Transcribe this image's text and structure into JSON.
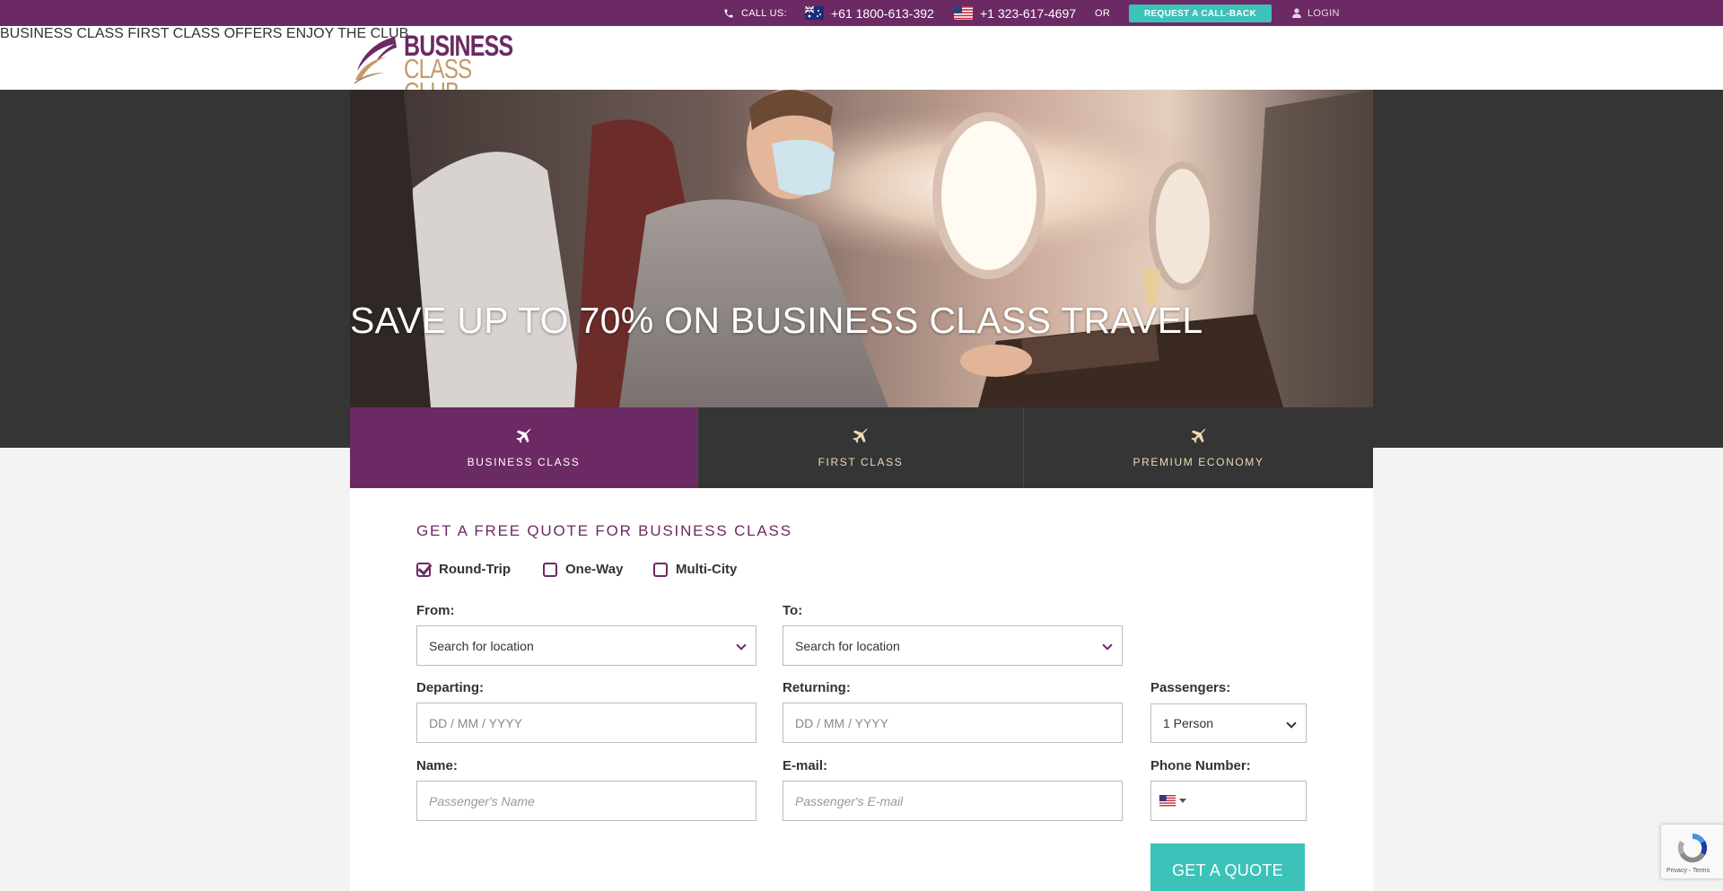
{
  "topbar": {
    "call_us": "CALL US:",
    "phone_au": "+61 1800-613-392",
    "phone_us": "+1 323-617-4697",
    "or": "OR",
    "callback": "REQUEST A CALL-BACK",
    "login": "LOGIN"
  },
  "logo": {
    "line1": "BUSINESS",
    "line2": "CLASS CLUB"
  },
  "nav": [
    "BUSINESS CLASS",
    "FIRST CLASS",
    "OFFERS",
    "ENJOY THE CLUB"
  ],
  "hero": {
    "title": "SAVE UP TO 70% ON BUSINESS CLASS TRAVEL"
  },
  "tabs": [
    {
      "label": "BUSINESS CLASS",
      "active": true
    },
    {
      "label": "FIRST CLASS",
      "active": false
    },
    {
      "label": "PREMIUM ECONOMY",
      "active": false
    }
  ],
  "form": {
    "title": "GET A FREE QUOTE FOR BUSINESS CLASS",
    "trip_types": [
      {
        "label": "Round-Trip",
        "checked": true
      },
      {
        "label": "One-Way",
        "checked": false
      },
      {
        "label": "Multi-City",
        "checked": false
      }
    ],
    "from_label": "From:",
    "from_value": "Search for location",
    "to_label": "To:",
    "to_value": "Search for location",
    "departing_label": "Departing:",
    "departing_placeholder": "DD / MM / YYYY",
    "returning_label": "Returning:",
    "returning_placeholder": "DD / MM / YYYY",
    "passengers_label": "Passengers:",
    "passengers_value": "1 Person",
    "name_label": "Name:",
    "name_placeholder": "Passenger's Name",
    "email_label": "E-mail:",
    "email_placeholder": "Passenger's E-mail",
    "phone_label": "Phone Number:",
    "submit": "GET A QUOTE"
  },
  "recaptcha": {
    "terms": "Privacy - Terms"
  },
  "colors": {
    "brand": "#6b2a63",
    "accent": "#3cc2b8",
    "gold": "#c49a6c",
    "dark": "#353535"
  },
  "icons": [
    "phone-icon",
    "au-flag-icon",
    "us-flag-icon",
    "user-icon",
    "plane-icon",
    "check-icon",
    "chevron-down-icon",
    "recaptcha-icon"
  ]
}
